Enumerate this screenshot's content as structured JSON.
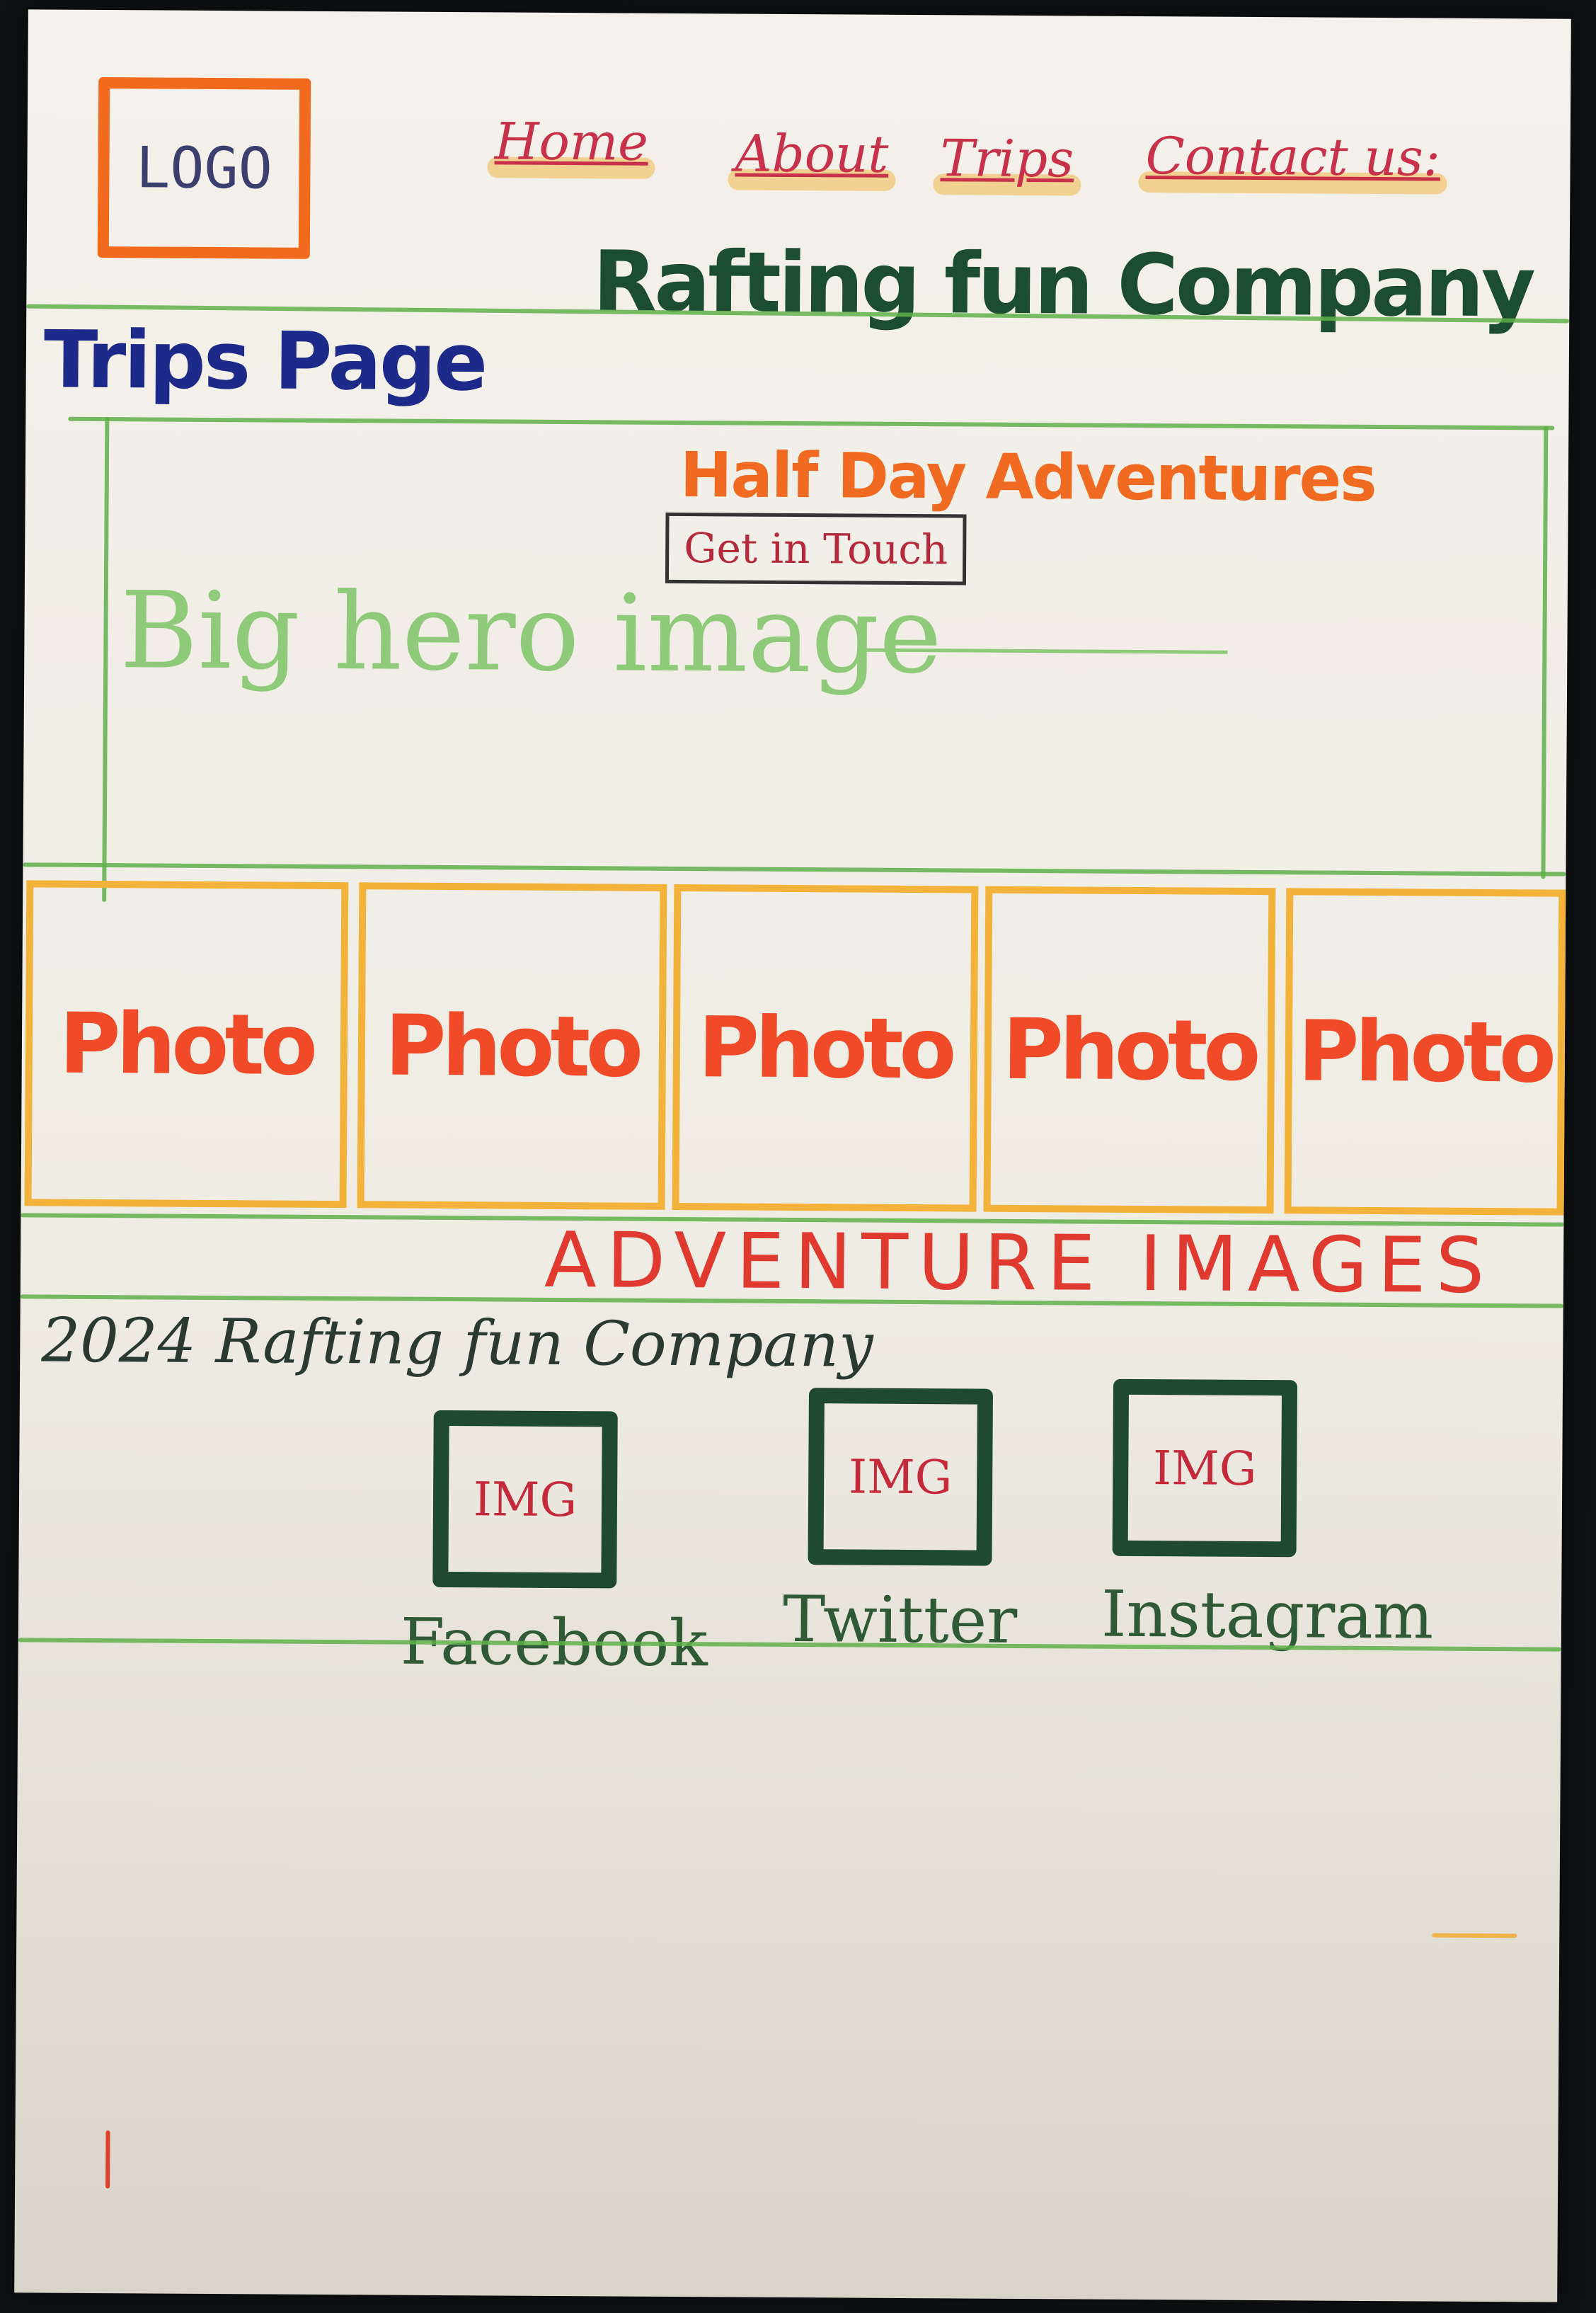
{
  "header": {
    "logo_label": "LOGO",
    "nav": [
      {
        "label": "Home"
      },
      {
        "label": "About"
      },
      {
        "label": "Trips"
      },
      {
        "label": "Contact us:"
      }
    ],
    "brand": "Rafting fun Company"
  },
  "page_title": "Trips Page",
  "hero": {
    "heading": "Half Day Adventures",
    "cta_label": "Get in Touch",
    "placeholder_text": "Big hero image"
  },
  "gallery": {
    "photos": [
      "Photo",
      "Photo",
      "Photo",
      "Photo",
      "Photo"
    ],
    "caption": "ADVENTURE IMAGES"
  },
  "footer": {
    "copyright": "2024 Rafting fun Company",
    "socials": [
      {
        "img": "IMG",
        "label": "Facebook"
      },
      {
        "img": "IMG",
        "label": "Twitter"
      },
      {
        "img": "IMG",
        "label": "Instagram"
      }
    ]
  },
  "colors": {
    "green_lines": "#5fb04a",
    "logo_orange": "#f26a1e",
    "brand_green": "#1c4d30",
    "title_blue": "#1d2a8a",
    "photo_red": "#f04a28",
    "photo_border": "#f3b23a"
  }
}
